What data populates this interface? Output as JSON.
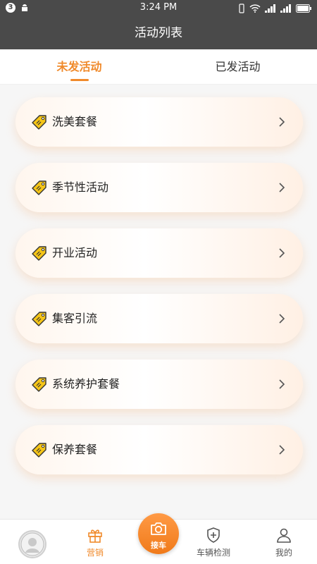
{
  "status_bar": {
    "time": "3:24 PM",
    "notification_count": "3"
  },
  "header": {
    "title": "活动列表"
  },
  "tabs": [
    {
      "label": "未发活动",
      "active": true
    },
    {
      "label": "已发活动",
      "active": false
    }
  ],
  "activities": [
    {
      "label": "洗美套餐"
    },
    {
      "label": "季节性活动"
    },
    {
      "label": "开业活动"
    },
    {
      "label": "集客引流"
    },
    {
      "label": "系统养护套餐"
    },
    {
      "label": "保养套餐"
    }
  ],
  "bottom_nav": {
    "items": [
      {
        "label": "营销",
        "icon": "gift-icon",
        "active": true
      },
      {
        "label": "接车",
        "icon": "camera-icon"
      },
      {
        "label": "车辆检测",
        "icon": "shield-plus-icon"
      },
      {
        "label": "我的",
        "icon": "user-icon"
      }
    ]
  },
  "colors": {
    "accent": "#f08a2b",
    "header_bg": "#4a4a4a",
    "page_bg": "#f6f6f6"
  }
}
